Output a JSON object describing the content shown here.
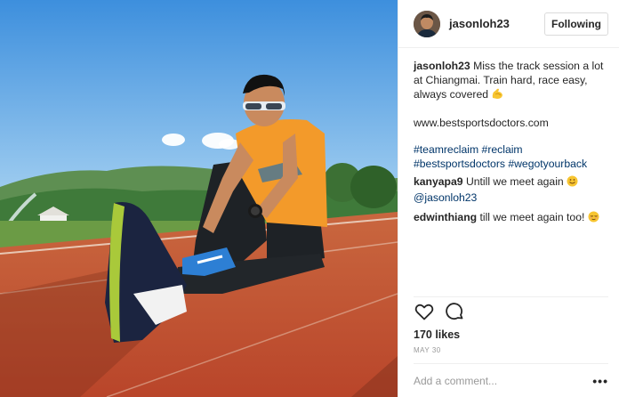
{
  "post": {
    "username": "jasonloh23",
    "follow_label": "Following",
    "caption": {
      "username": "jasonloh23",
      "text": "Miss the track session a lot at Chiangmai. Train hard, race easy, always covered",
      "emoji": "flexed-biceps-emoji"
    },
    "website": "www.bestsportsdoctors.com",
    "hashtags": "#teamreclaim #reclaim #bestsportsdoctors #wegotyourback",
    "comments": [
      {
        "username": "kanyapa9",
        "text": "Untill we meet again",
        "emoji": "smile-emoji",
        "mention": "@jasonloh23"
      },
      {
        "username": "edwinthiang",
        "text": "till we meet again too!",
        "emoji": "relieved-emoji"
      }
    ],
    "likes": "170 likes",
    "date": "MAY 30",
    "add_comment_placeholder": "Add a comment...",
    "more_label": "•••"
  },
  "icons": [
    "heart-icon",
    "comment-icon",
    "more-options-icon"
  ],
  "colors": {
    "link": "#003569",
    "text": "#262626",
    "muted": "#999999",
    "border": "#efefef",
    "track": "#c8532f",
    "sky": "#4d9ee0"
  }
}
